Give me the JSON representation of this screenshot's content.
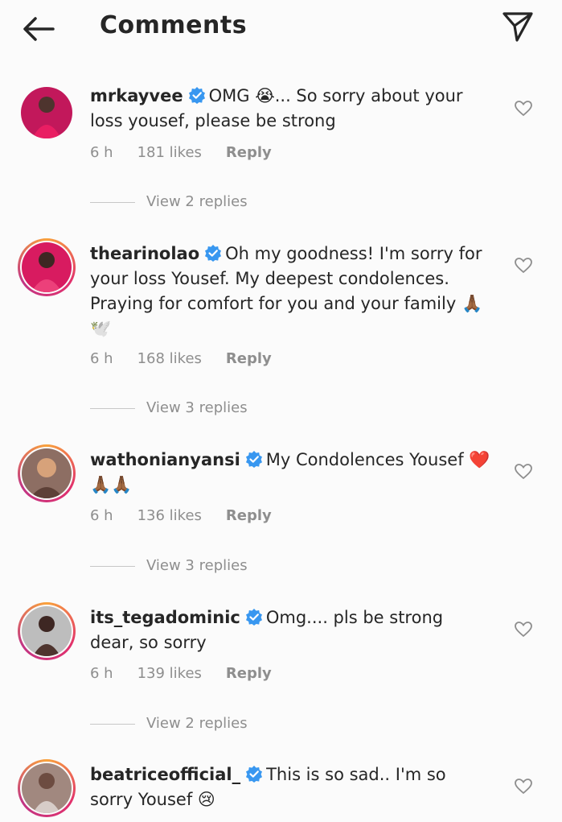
{
  "header": {
    "title": "Comments"
  },
  "comments": [
    {
      "username": "mrkayvee",
      "text": "OMG 😭... So sorry about your loss yousef, please be strong",
      "time": "6 h",
      "likes": "181 likes",
      "reply": "Reply",
      "view_replies": "View 2 replies",
      "avatar_color": "#c2185b"
    },
    {
      "username": "thearinolao",
      "text": "Oh my goodness! I'm sorry for your loss Yousef. My deepest condolences. Praying for comfort for you and your family 🙏🏾🕊️",
      "time": "6 h",
      "likes": "168 likes",
      "reply": "Reply",
      "view_replies": "View 3 replies",
      "avatar_color": "#d81b60"
    },
    {
      "username": "wathonianyansi",
      "text": "My Condolences Yousef ❤️🙏🏾🙏🏾",
      "time": "6 h",
      "likes": "136 likes",
      "reply": "Reply",
      "view_replies": "View 3 replies",
      "avatar_color": "#8d6e63"
    },
    {
      "username": "its_tegadominic",
      "text": "Omg.... pls be strong dear, so sorry",
      "time": "6 h",
      "likes": "139 likes",
      "reply": "Reply",
      "view_replies": "View 2 replies",
      "avatar_color": "#5d4037"
    },
    {
      "username": "beatriceofficial_",
      "text": "This is so sad.. I'm so sorry Yousef 😢",
      "avatar_color": "#a1887f"
    }
  ],
  "colors": {
    "verified": "#3897f0",
    "muted": "#8e8e8e"
  },
  "icons": {
    "back": "arrow-left-icon",
    "send": "send-icon",
    "verified": "verified-badge-icon",
    "like": "heart-icon"
  }
}
